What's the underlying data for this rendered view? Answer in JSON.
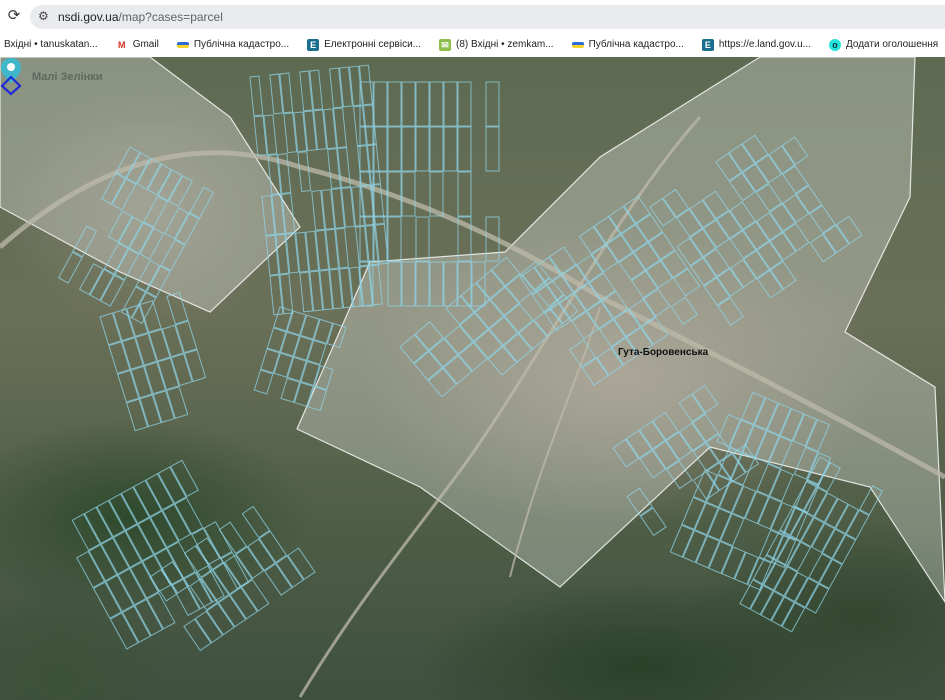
{
  "browser": {
    "url_host": "nsdi.gov.ua",
    "url_path": "/map?cases=parcel"
  },
  "bookmarks": [
    {
      "label": "Вхідні • tanuskatan...",
      "icon": "none"
    },
    {
      "label": "Gmail",
      "icon": "gmail-icon"
    },
    {
      "label": "Публічна кадастро...",
      "icon": "ukraine-map-icon"
    },
    {
      "label": "Електронні сервіси...",
      "icon": "e-service-icon"
    },
    {
      "label": "(8) Вхідні • zemkam...",
      "icon": "mail-icon"
    },
    {
      "label": "Публічна кадастро...",
      "icon": "ukraine-map-icon"
    },
    {
      "label": "https://e.land.gov.u...",
      "icon": "e-service-icon"
    },
    {
      "label": "Додати оголошення",
      "icon": "olx-icon"
    }
  ],
  "map": {
    "place_labels": [
      "Гута-Боровенська",
      "Малі Зелінки"
    ],
    "colors": {
      "settlement_fill": "#ffffff",
      "parcel_line": "#8fd4e8",
      "marker": "#3fb6c9",
      "selected_parcel": "#1f2ad6"
    }
  }
}
